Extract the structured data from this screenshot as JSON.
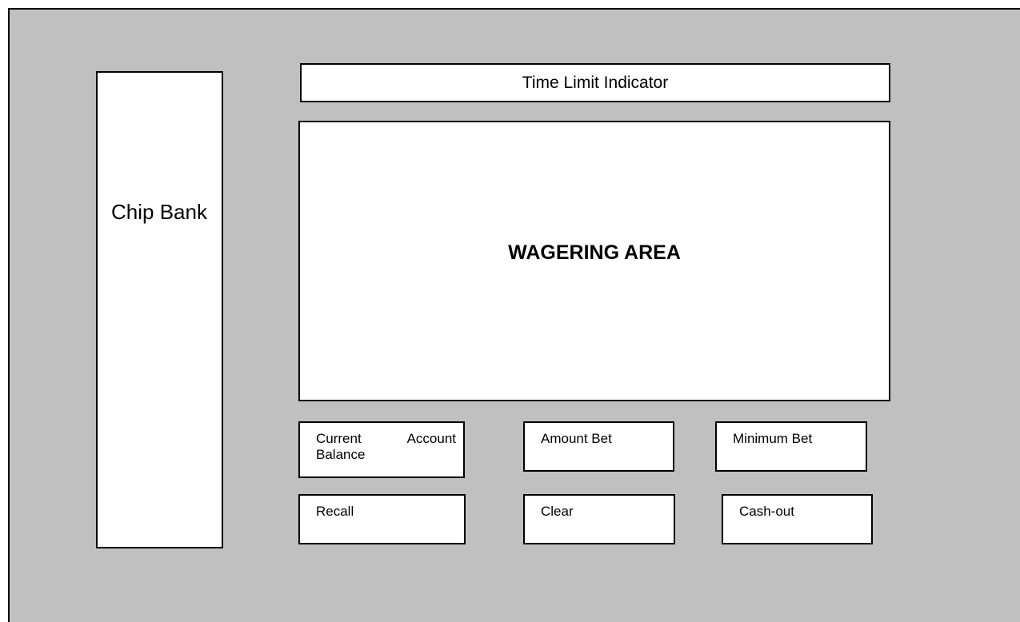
{
  "chip_bank": {
    "label": "Chip Bank"
  },
  "time_limit": {
    "label": "Time Limit Indicator"
  },
  "wagering_area": {
    "label": "WAGERING AREA"
  },
  "info_boxes": {
    "current_balance": "Current Account Balance",
    "amount_bet": "Amount Bet",
    "minimum_bet": "Minimum Bet"
  },
  "buttons": {
    "recall": "Recall",
    "clear": "Clear",
    "cash_out": "Cash-out"
  }
}
